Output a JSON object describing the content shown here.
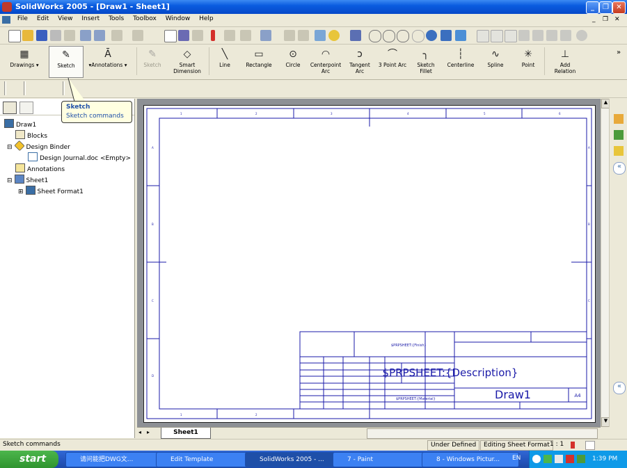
{
  "window": {
    "title": "SolidWorks 2005 - [Draw1 - Sheet1]"
  },
  "menubar": [
    "File",
    "Edit",
    "View",
    "Insert",
    "Tools",
    "Toolbox",
    "Window",
    "Help"
  ],
  "command_manager": {
    "tabs": [
      "Drawings",
      "Sketch",
      "Annotations"
    ],
    "tools": [
      {
        "label": "Sketch",
        "icon": "sketch-icon",
        "enabled": false
      },
      {
        "label": "Smart Dimension",
        "icon": "smart-dimension-icon"
      },
      {
        "label": "Line",
        "icon": "line-icon"
      },
      {
        "label": "Rectangle",
        "icon": "rectangle-icon"
      },
      {
        "label": "Circle",
        "icon": "circle-icon"
      },
      {
        "label": "Centerpoint Arc",
        "icon": "centerpoint-arc-icon"
      },
      {
        "label": "Tangent Arc",
        "icon": "tangent-arc-icon"
      },
      {
        "label": "3 Point Arc",
        "icon": "three-point-arc-icon"
      },
      {
        "label": "Sketch Fillet",
        "icon": "sketch-fillet-icon"
      },
      {
        "label": "Centerline",
        "icon": "centerline-icon"
      },
      {
        "label": "Spline",
        "icon": "spline-icon"
      },
      {
        "label": "Point",
        "icon": "point-icon"
      },
      {
        "label": "Add Relation",
        "icon": "add-relation-icon"
      }
    ],
    "overflow": "»"
  },
  "tooltip": {
    "title": "Sketch",
    "text": "Sketch commands"
  },
  "feature_tree": [
    {
      "label": "Draw1",
      "level": 0,
      "icon": "drawing-icon"
    },
    {
      "label": "Blocks",
      "level": 1,
      "icon": "blocks-icon"
    },
    {
      "label": "Design Binder",
      "level": 1,
      "icon": "design-binder-icon"
    },
    {
      "label": "Design Journal.doc <Empty>",
      "level": 2,
      "icon": "document-icon"
    },
    {
      "label": "Annotations",
      "level": 1,
      "icon": "annotations-icon"
    },
    {
      "label": "Sheet1",
      "level": 1,
      "icon": "sheet-icon"
    },
    {
      "label": "Sheet Format1",
      "level": 2,
      "icon": "sheet-format-icon"
    }
  ],
  "drawing": {
    "zone_numbers": [
      "1",
      "2",
      "3",
      "4",
      "5",
      "6"
    ],
    "zone_letters": [
      "A",
      "B",
      "C",
      "D"
    ],
    "title_block": {
      "prp_sheet": "$PRPSHEET:{Description}",
      "part_no": "Draw1",
      "size": "A4",
      "prps_finish": "$PRPSHEET:{Finish}",
      "prps_material": "$PRPSHEET:{Material}"
    }
  },
  "sheet_tab": "Sheet1",
  "statusbar": {
    "left": "Sketch commands",
    "state": "Under Defined",
    "mode": "Editing Sheet Format",
    "scale": "1 : 1"
  },
  "taskbar": {
    "start": "start",
    "items": [
      {
        "label": "请问能把DWG文..."
      },
      {
        "label": "Edit Template"
      },
      {
        "label": "SolidWorks 2005 - ...",
        "active": true
      },
      {
        "label": "7 - Paint"
      },
      {
        "label": "8 - Windows Pictur..."
      }
    ],
    "lang": "EN",
    "time": "1:39 PM"
  }
}
